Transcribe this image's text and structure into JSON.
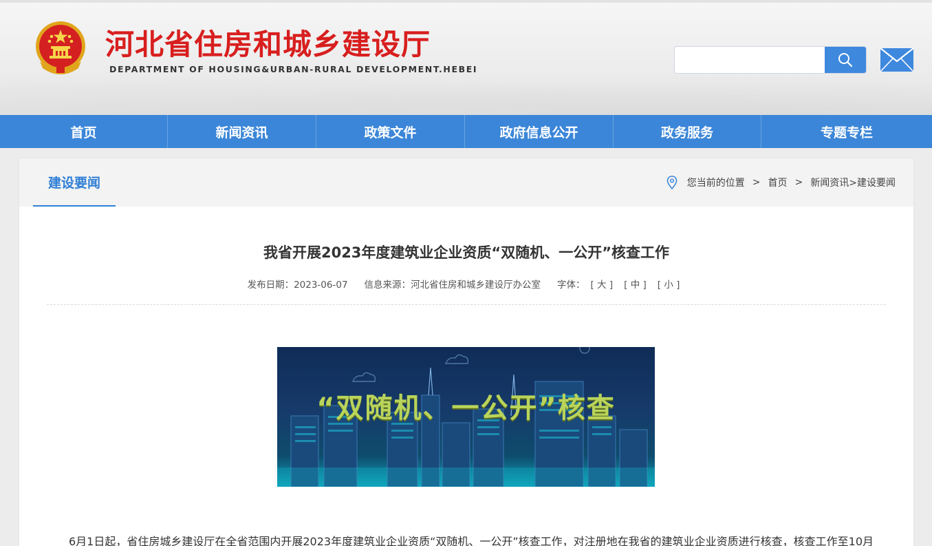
{
  "header": {
    "site_title": "河北省住房和城乡建设厅",
    "site_subtitle": "DEPARTMENT OF HOUSING&URBAN-RURAL DEVELOPMENT.HEBEI",
    "search_placeholder": "",
    "icons": {
      "search": "search-icon",
      "mail": "mail-icon",
      "emblem": "national-emblem-icon"
    }
  },
  "nav": {
    "items": [
      {
        "label": "首页"
      },
      {
        "label": "新闻资讯"
      },
      {
        "label": "政策文件"
      },
      {
        "label": "政府信息公开"
      },
      {
        "label": "政务服务"
      },
      {
        "label": "专题专栏"
      }
    ]
  },
  "section": {
    "tab_label": "建设要闻",
    "breadcrumb": {
      "prefix": "您当前的位置",
      "sep": ">",
      "home": "首页",
      "path": "新闻资讯>建设要闻"
    }
  },
  "article": {
    "title": "我省开展2023年度建筑业企业资质“双随机、一公开”核查工作",
    "publish_date": "发布日期：2023-06-07",
    "source": "信息来源：河北省住房和城乡建设厅办公室",
    "font_size_label": "字体：",
    "font_large": "[ 大 ]",
    "font_medium": "[ 中 ]",
    "font_small": "[ 小 ]",
    "banner_text": "“双随机、一公开”核查",
    "body_first_line": "6月1日起，省住房城乡建设厅在全省范围内开展2023年度建筑业企业资质“双随机、一公开”核查工作，对注册地在我省的建筑业企业资质进行核查，核查工作至10月"
  },
  "colors": {
    "brand_red": "#d81e1e",
    "nav_blue": "#3b86d8",
    "accent_blue": "#2f7fd6",
    "banner_green": "#b9d45a"
  }
}
